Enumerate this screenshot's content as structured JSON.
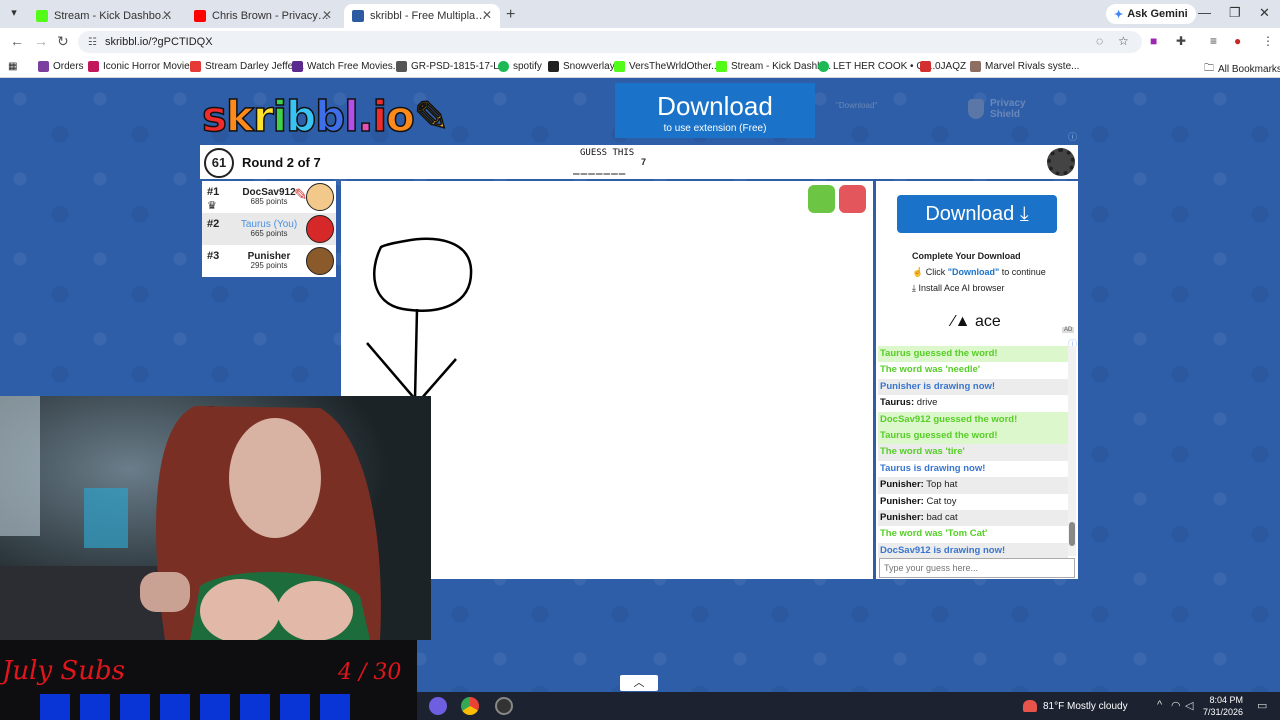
{
  "browser": {
    "tabs": [
      {
        "label": "Stream - Kick Dashboard",
        "fav_color": "#53fc18"
      },
      {
        "label": "Chris Brown - Privacy (Offici",
        "fav_color": "#ff0000"
      },
      {
        "label": "skribbl - Free Multiplayer Draw",
        "fav_color": "#2b5aa3"
      }
    ],
    "new_tab": "+",
    "gemini": "Ask Gemini",
    "url": "skribbl.io/?gPCTIDQX",
    "bookmarks": [
      {
        "label": "Orders",
        "color": "#7b3fa0"
      },
      {
        "label": "Iconic Horror Movie...",
        "color": "#c2185b"
      },
      {
        "label": "Stream Darley Jeffer...",
        "color": "#e53935"
      },
      {
        "label": "Watch Free Movies...",
        "color": "#5b2a8e"
      },
      {
        "label": "GR-PSD-1815-17-L...",
        "color": "#555555"
      },
      {
        "label": "spotify",
        "color": "#1db954"
      },
      {
        "label": "Snowverlay",
        "color": "#222222"
      },
      {
        "label": "VersTheWrldOther...",
        "color": "#53fc18"
      },
      {
        "label": "Stream - Kick Dashb...",
        "color": "#53fc18"
      },
      {
        "label": "LET HER COOK • GI...",
        "color": "#1db954"
      },
      {
        "label": "0JAQZ",
        "color": "#d32f2f"
      },
      {
        "label": "Marvel Rivals syste...",
        "color": "#8d6e63"
      }
    ],
    "all_bookmarks": "All Bookmarks"
  },
  "ads": {
    "top_download": "Download",
    "top_download_sub": "to use extension (Free)",
    "privacy_shield": "Privacy Shield",
    "side_download": "Download ⤓",
    "complete_title": "Complete Your Download",
    "step1_pre": "Click ",
    "step1_hl": "\"Download\"",
    "step1_post": " to continue",
    "step2": "Install Ace AI browser",
    "ace_brand": "ace",
    "ad_tag": "AD"
  },
  "game": {
    "timer": "61",
    "round": "Round 2 of 7",
    "guess_label": "GUESS THIS",
    "blanks": "_______",
    "word_length": "7",
    "players": [
      {
        "rank": "#1",
        "name": "DocSav912",
        "points": "685 points",
        "you": false,
        "avatar_color": "#f3c98b"
      },
      {
        "rank": "#2",
        "name": "Taurus (You)",
        "points": "665 points",
        "you": true,
        "avatar_color": "#d62828"
      },
      {
        "rank": "#3",
        "name": "Punisher",
        "points": "295 points",
        "you": false,
        "avatar_color": "#8b5a2b"
      }
    ]
  },
  "chat": {
    "messages": [
      {
        "author": "",
        "text": "Taurus guessed the word!",
        "style": "green",
        "bg": "greenbg"
      },
      {
        "author": "",
        "text": "The word was 'needle'",
        "style": "green",
        "bg": ""
      },
      {
        "author": "",
        "text": "Punisher is drawing now!",
        "style": "blue",
        "bg": "alt"
      },
      {
        "author": "Taurus:",
        "text": " drive",
        "style": "",
        "bg": ""
      },
      {
        "author": "",
        "text": "DocSav912 guessed the word!",
        "style": "green",
        "bg": "greenbg"
      },
      {
        "author": "",
        "text": "Taurus guessed the word!",
        "style": "green",
        "bg": "greenbg"
      },
      {
        "author": "",
        "text": "The word was 'tire'",
        "style": "green",
        "bg": "alt"
      },
      {
        "author": "",
        "text": "Taurus is drawing now!",
        "style": "blue",
        "bg": ""
      },
      {
        "author": "Punisher:",
        "text": " Top hat",
        "style": "",
        "bg": "alt"
      },
      {
        "author": "Punisher:",
        "text": " Cat toy",
        "style": "",
        "bg": ""
      },
      {
        "author": "Punisher:",
        "text": " bad cat",
        "style": "",
        "bg": "alt"
      },
      {
        "author": "",
        "text": "The word was 'Tom Cat'",
        "style": "green",
        "bg": ""
      },
      {
        "author": "",
        "text": "DocSav912 is drawing now!",
        "style": "blue",
        "bg": "alt"
      }
    ],
    "input_placeholder": "Type your guess here..."
  },
  "overlay": {
    "subs_title": "July Subs",
    "subs_count": "4 / 30"
  },
  "taskbar": {
    "weather": "81°F  Mostly cloudy",
    "time": "8:04 PM",
    "date": "7/31/2026"
  }
}
